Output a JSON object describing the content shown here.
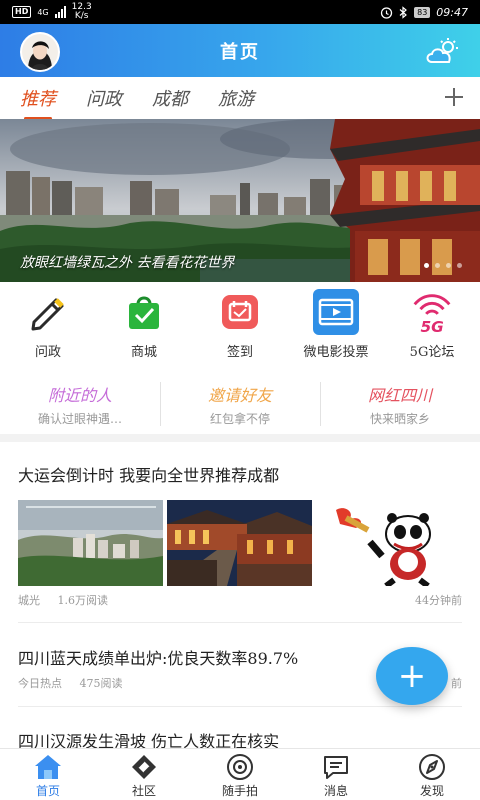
{
  "statusbar": {
    "hd": "HD",
    "network": "4G",
    "speed_value": "12.3",
    "speed_unit": "K/s",
    "battery": "83",
    "time": "09:47"
  },
  "header": {
    "title": "首页"
  },
  "tabs": [
    {
      "label": "推荐",
      "active": true
    },
    {
      "label": "问政"
    },
    {
      "label": "成都"
    },
    {
      "label": "旅游"
    }
  ],
  "banner": {
    "caption": "放眼红墙绿瓦之外 去看看花花世界",
    "page_count": 4,
    "active_page": 0
  },
  "quick": [
    {
      "label": "问政",
      "icon": "pen-icon"
    },
    {
      "label": "商城",
      "icon": "shopping-bag-icon"
    },
    {
      "label": "签到",
      "icon": "calendar-check-icon"
    },
    {
      "label": "微电影投票",
      "icon": "film-icon"
    },
    {
      "label": "5G论坛",
      "icon": "5g-signal-icon"
    }
  ],
  "triple": [
    {
      "title": "附近的人",
      "sub": "确认过眼神遇…",
      "color": "#c56cd8"
    },
    {
      "title": "邀请好友",
      "sub": "红包拿不停",
      "color": "#f0a64a"
    },
    {
      "title": "网红四川",
      "sub": "快来晒家乡",
      "color": "#e4525f"
    }
  ],
  "articles": [
    {
      "title": "大运会倒计时 我要向全世界推荐成都",
      "source": "城光",
      "reads": "1.6万阅读",
      "time": "44分钟前"
    },
    {
      "title": "四川蓝天成绩单出炉:优良天数率89.7%",
      "source": "今日热点",
      "reads": "475阅读",
      "time": "前"
    },
    {
      "title": "四川汉源发生滑坡 伤亡人数正在核实"
    }
  ],
  "fab": {
    "label": "+"
  },
  "nav": [
    {
      "label": "首页",
      "icon": "home-icon",
      "active": true
    },
    {
      "label": "社区",
      "icon": "community-icon"
    },
    {
      "label": "随手拍",
      "icon": "camera-icon"
    },
    {
      "label": "消息",
      "icon": "message-icon"
    },
    {
      "label": "发现",
      "icon": "discover-icon"
    }
  ],
  "colors": {
    "accent": "#e0501e",
    "brand_blue": "#2e7de6",
    "fab": "#34a7ee"
  }
}
